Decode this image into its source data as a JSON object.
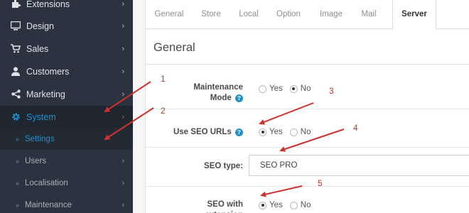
{
  "sidebar": {
    "items": [
      {
        "label": "Extensions",
        "icon": "puzzle-icon"
      },
      {
        "label": "Design",
        "icon": "monitor-icon"
      },
      {
        "label": "Sales",
        "icon": "cart-icon"
      },
      {
        "label": "Customers",
        "icon": "user-icon"
      },
      {
        "label": "Marketing",
        "icon": "share-icon"
      },
      {
        "label": "System",
        "icon": "gear-icon"
      }
    ],
    "sub_items": [
      {
        "label": "Settings"
      },
      {
        "label": "Users"
      },
      {
        "label": "Localisation"
      },
      {
        "label": "Maintenance"
      }
    ],
    "chevron": "›",
    "bullet": "»"
  },
  "tabs": [
    "General",
    "Store",
    "Local",
    "Option",
    "Image",
    "Mail",
    "Server"
  ],
  "section_title": "General",
  "form": {
    "maintenance": {
      "label_line1": "Maintenance",
      "label_line2": "Mode",
      "yes": "Yes",
      "no": "No",
      "value": "No"
    },
    "seo_urls": {
      "label": "Use SEO URLs",
      "yes": "Yes",
      "no": "No",
      "value": "Yes"
    },
    "seo_type": {
      "label": "SEO type:",
      "value": "SEO PRO"
    },
    "seo_with": {
      "label_line1": "SEO with",
      "label_line2": "extension",
      "yes": "Yes",
      "no": "No",
      "value": "Yes"
    },
    "help": "?"
  },
  "annotations": [
    "1",
    "2",
    "3",
    "4",
    "5"
  ],
  "colors": {
    "sidebar_bg": "#2b3340",
    "accent": "#1e91cf",
    "arrow": "#d0312d"
  }
}
